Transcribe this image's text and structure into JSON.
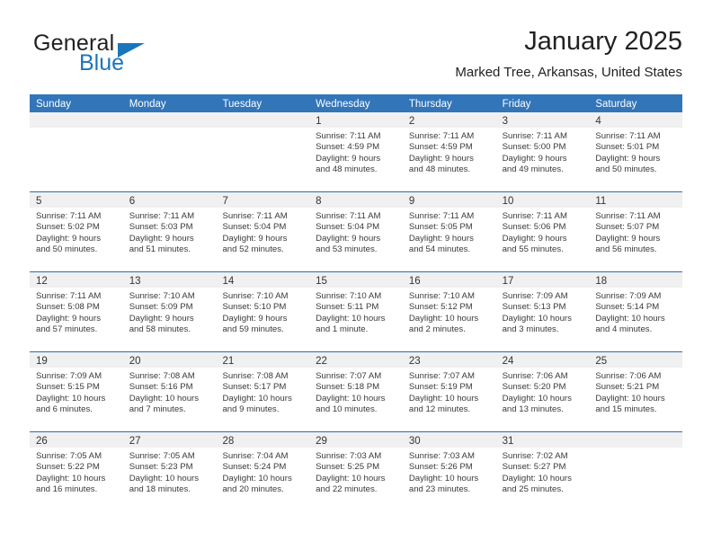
{
  "logo": {
    "primary_text": "General",
    "secondary_text": "Blue",
    "accent_color": "#1b75bb",
    "primary_color": "#231f20",
    "triangle_icon": "logo-triangle-icon"
  },
  "header": {
    "title": "January 2025",
    "subtitle": "Marked Tree, Arkansas, United States"
  },
  "calendar": {
    "header_bg": "#3275b9",
    "header_text_color": "#ffffff",
    "daynum_strip_bg": "#f0f0f0",
    "weekdays": [
      "Sunday",
      "Monday",
      "Tuesday",
      "Wednesday",
      "Thursday",
      "Friday",
      "Saturday"
    ],
    "weeks": [
      [
        {
          "day": "",
          "empty": true
        },
        {
          "day": "",
          "empty": true
        },
        {
          "day": "",
          "empty": true
        },
        {
          "day": "1",
          "sunrise": "Sunrise: 7:11 AM",
          "sunset": "Sunset: 4:59 PM",
          "daylight_1": "Daylight: 9 hours",
          "daylight_2": "and 48 minutes."
        },
        {
          "day": "2",
          "sunrise": "Sunrise: 7:11 AM",
          "sunset": "Sunset: 4:59 PM",
          "daylight_1": "Daylight: 9 hours",
          "daylight_2": "and 48 minutes."
        },
        {
          "day": "3",
          "sunrise": "Sunrise: 7:11 AM",
          "sunset": "Sunset: 5:00 PM",
          "daylight_1": "Daylight: 9 hours",
          "daylight_2": "and 49 minutes."
        },
        {
          "day": "4",
          "sunrise": "Sunrise: 7:11 AM",
          "sunset": "Sunset: 5:01 PM",
          "daylight_1": "Daylight: 9 hours",
          "daylight_2": "and 50 minutes."
        }
      ],
      [
        {
          "day": "5",
          "sunrise": "Sunrise: 7:11 AM",
          "sunset": "Sunset: 5:02 PM",
          "daylight_1": "Daylight: 9 hours",
          "daylight_2": "and 50 minutes."
        },
        {
          "day": "6",
          "sunrise": "Sunrise: 7:11 AM",
          "sunset": "Sunset: 5:03 PM",
          "daylight_1": "Daylight: 9 hours",
          "daylight_2": "and 51 minutes."
        },
        {
          "day": "7",
          "sunrise": "Sunrise: 7:11 AM",
          "sunset": "Sunset: 5:04 PM",
          "daylight_1": "Daylight: 9 hours",
          "daylight_2": "and 52 minutes."
        },
        {
          "day": "8",
          "sunrise": "Sunrise: 7:11 AM",
          "sunset": "Sunset: 5:04 PM",
          "daylight_1": "Daylight: 9 hours",
          "daylight_2": "and 53 minutes."
        },
        {
          "day": "9",
          "sunrise": "Sunrise: 7:11 AM",
          "sunset": "Sunset: 5:05 PM",
          "daylight_1": "Daylight: 9 hours",
          "daylight_2": "and 54 minutes."
        },
        {
          "day": "10",
          "sunrise": "Sunrise: 7:11 AM",
          "sunset": "Sunset: 5:06 PM",
          "daylight_1": "Daylight: 9 hours",
          "daylight_2": "and 55 minutes."
        },
        {
          "day": "11",
          "sunrise": "Sunrise: 7:11 AM",
          "sunset": "Sunset: 5:07 PM",
          "daylight_1": "Daylight: 9 hours",
          "daylight_2": "and 56 minutes."
        }
      ],
      [
        {
          "day": "12",
          "sunrise": "Sunrise: 7:11 AM",
          "sunset": "Sunset: 5:08 PM",
          "daylight_1": "Daylight: 9 hours",
          "daylight_2": "and 57 minutes."
        },
        {
          "day": "13",
          "sunrise": "Sunrise: 7:10 AM",
          "sunset": "Sunset: 5:09 PM",
          "daylight_1": "Daylight: 9 hours",
          "daylight_2": "and 58 minutes."
        },
        {
          "day": "14",
          "sunrise": "Sunrise: 7:10 AM",
          "sunset": "Sunset: 5:10 PM",
          "daylight_1": "Daylight: 9 hours",
          "daylight_2": "and 59 minutes."
        },
        {
          "day": "15",
          "sunrise": "Sunrise: 7:10 AM",
          "sunset": "Sunset: 5:11 PM",
          "daylight_1": "Daylight: 10 hours",
          "daylight_2": "and 1 minute."
        },
        {
          "day": "16",
          "sunrise": "Sunrise: 7:10 AM",
          "sunset": "Sunset: 5:12 PM",
          "daylight_1": "Daylight: 10 hours",
          "daylight_2": "and 2 minutes."
        },
        {
          "day": "17",
          "sunrise": "Sunrise: 7:09 AM",
          "sunset": "Sunset: 5:13 PM",
          "daylight_1": "Daylight: 10 hours",
          "daylight_2": "and 3 minutes."
        },
        {
          "day": "18",
          "sunrise": "Sunrise: 7:09 AM",
          "sunset": "Sunset: 5:14 PM",
          "daylight_1": "Daylight: 10 hours",
          "daylight_2": "and 4 minutes."
        }
      ],
      [
        {
          "day": "19",
          "sunrise": "Sunrise: 7:09 AM",
          "sunset": "Sunset: 5:15 PM",
          "daylight_1": "Daylight: 10 hours",
          "daylight_2": "and 6 minutes."
        },
        {
          "day": "20",
          "sunrise": "Sunrise: 7:08 AM",
          "sunset": "Sunset: 5:16 PM",
          "daylight_1": "Daylight: 10 hours",
          "daylight_2": "and 7 minutes."
        },
        {
          "day": "21",
          "sunrise": "Sunrise: 7:08 AM",
          "sunset": "Sunset: 5:17 PM",
          "daylight_1": "Daylight: 10 hours",
          "daylight_2": "and 9 minutes."
        },
        {
          "day": "22",
          "sunrise": "Sunrise: 7:07 AM",
          "sunset": "Sunset: 5:18 PM",
          "daylight_1": "Daylight: 10 hours",
          "daylight_2": "and 10 minutes."
        },
        {
          "day": "23",
          "sunrise": "Sunrise: 7:07 AM",
          "sunset": "Sunset: 5:19 PM",
          "daylight_1": "Daylight: 10 hours",
          "daylight_2": "and 12 minutes."
        },
        {
          "day": "24",
          "sunrise": "Sunrise: 7:06 AM",
          "sunset": "Sunset: 5:20 PM",
          "daylight_1": "Daylight: 10 hours",
          "daylight_2": "and 13 minutes."
        },
        {
          "day": "25",
          "sunrise": "Sunrise: 7:06 AM",
          "sunset": "Sunset: 5:21 PM",
          "daylight_1": "Daylight: 10 hours",
          "daylight_2": "and 15 minutes."
        }
      ],
      [
        {
          "day": "26",
          "sunrise": "Sunrise: 7:05 AM",
          "sunset": "Sunset: 5:22 PM",
          "daylight_1": "Daylight: 10 hours",
          "daylight_2": "and 16 minutes."
        },
        {
          "day": "27",
          "sunrise": "Sunrise: 7:05 AM",
          "sunset": "Sunset: 5:23 PM",
          "daylight_1": "Daylight: 10 hours",
          "daylight_2": "and 18 minutes."
        },
        {
          "day": "28",
          "sunrise": "Sunrise: 7:04 AM",
          "sunset": "Sunset: 5:24 PM",
          "daylight_1": "Daylight: 10 hours",
          "daylight_2": "and 20 minutes."
        },
        {
          "day": "29",
          "sunrise": "Sunrise: 7:03 AM",
          "sunset": "Sunset: 5:25 PM",
          "daylight_1": "Daylight: 10 hours",
          "daylight_2": "and 22 minutes."
        },
        {
          "day": "30",
          "sunrise": "Sunrise: 7:03 AM",
          "sunset": "Sunset: 5:26 PM",
          "daylight_1": "Daylight: 10 hours",
          "daylight_2": "and 23 minutes."
        },
        {
          "day": "31",
          "sunrise": "Sunrise: 7:02 AM",
          "sunset": "Sunset: 5:27 PM",
          "daylight_1": "Daylight: 10 hours",
          "daylight_2": "and 25 minutes."
        },
        {
          "day": "",
          "empty": true
        }
      ]
    ]
  }
}
